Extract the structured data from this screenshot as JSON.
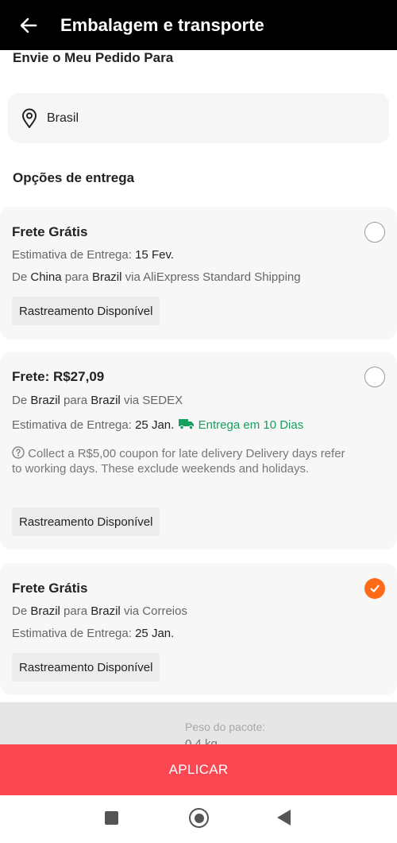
{
  "header": {
    "title": "Embalagem e transporte"
  },
  "ship_to": {
    "label": "Envie o Meu Pedido Para",
    "country": "Brasil"
  },
  "options_title": "Opções de entrega",
  "options": [
    {
      "title": "Frete Grátis",
      "estimate_label": "Estimativa de Entrega:",
      "estimate_value": "15 Fev.",
      "from_label": "De",
      "from": "China",
      "to_label": "para",
      "to": "Brazil",
      "via_label": "via",
      "carrier": "AliExpress Standard Shipping",
      "tracking": "Rastreamento Disponível",
      "selected": false
    },
    {
      "title": "Frete: R$27,09",
      "from_label": "De",
      "from": "Brazil",
      "to_label": "para",
      "to": "Brazil",
      "via_label": "via",
      "carrier": "SEDEX",
      "estimate_label": "Estimativa de Entrega:",
      "estimate_value": "25 Jan.",
      "fast_delivery": "Entrega em 10 Dias",
      "note": "Collect a R$5,00 coupon for late delivery Delivery days refer to working days. These exclude weekends and holidays.",
      "tracking": "Rastreamento Disponível",
      "selected": false
    },
    {
      "title": "Frete Grátis",
      "from_label": "De",
      "from": "Brazil",
      "to_label": "para",
      "to": "Brazil",
      "via_label": "via",
      "carrier": "Correios",
      "estimate_label": "Estimativa de Entrega:",
      "estimate_value": "25 Jan.",
      "tracking": "Rastreamento Disponível",
      "selected": true
    }
  ],
  "package": {
    "weight_label": "Peso do pacote:",
    "weight_value": "0.4 kg"
  },
  "apply_label": "APLICAR",
  "colors": {
    "accent": "#fa4752",
    "selected": "#ff6a19",
    "green": "#16a05d"
  },
  "icons": {
    "back": "arrow-left-icon",
    "pin": "location-pin-icon",
    "truck": "truck-icon",
    "help": "question-circle-icon",
    "check": "check-icon"
  }
}
